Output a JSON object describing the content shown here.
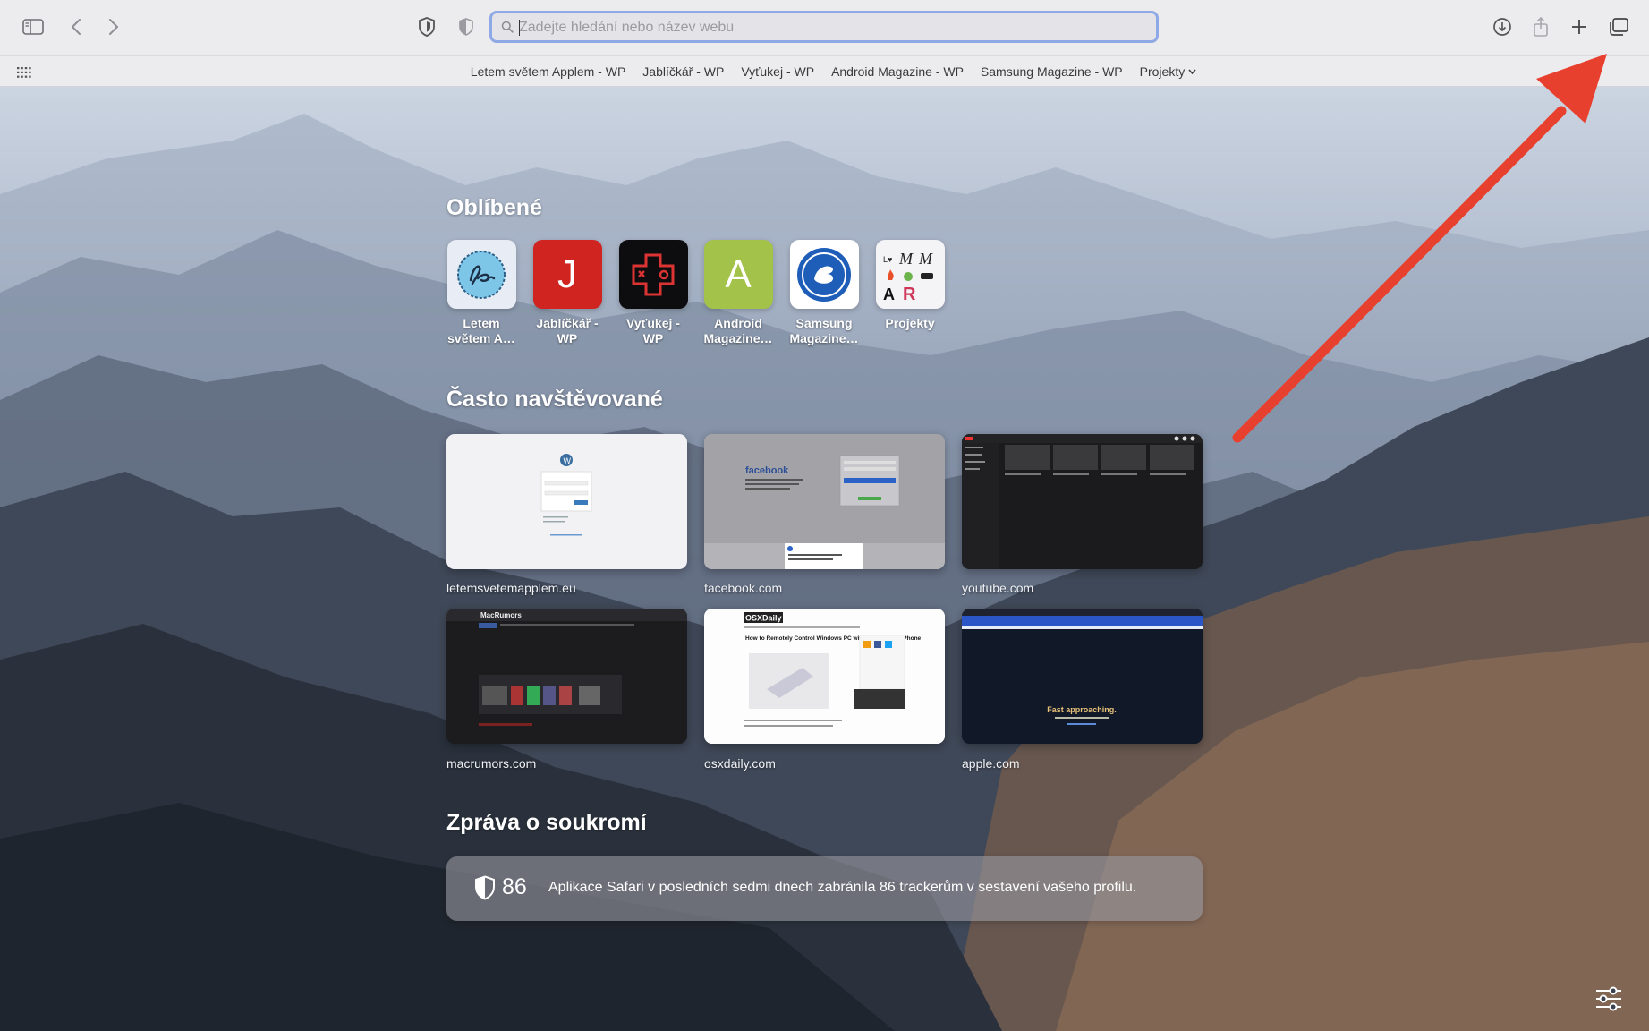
{
  "toolbar": {
    "sidebar_icon": "sidebar-icon",
    "back_icon": "chevron-left-icon",
    "forward_icon": "chevron-right-icon",
    "privacy_icon": "privacy-shield-icon",
    "url_placeholder": "Zadejte hledání nebo název webu",
    "downloads_icon": "download-icon",
    "share_icon": "share-icon",
    "new_tab_icon": "plus-icon",
    "tab_overview_icon": "tab-overview-icon"
  },
  "bookmarks": {
    "items": [
      "Letem světem Applem - WP",
      "Jablíčkář - WP",
      "Vyťukej - WP",
      "Android Magazine - WP",
      "Samsung Magazine - WP"
    ],
    "folder": "Projekty"
  },
  "favorites": {
    "title": "Oblíbené",
    "items": [
      {
        "line1": "Letem",
        "line2": "světem A…"
      },
      {
        "line1": "Jablíčkář -",
        "line2": "WP",
        "letter": "J"
      },
      {
        "line1": "Vyťukej -",
        "line2": "WP"
      },
      {
        "line1": "Android",
        "line2": "Magazine…",
        "letter": "A"
      },
      {
        "line1": "Samsung",
        "line2": "Magazine…"
      },
      {
        "line1": "Projekty",
        "line2": ""
      }
    ]
  },
  "frequent": {
    "title": "Často navštěvované",
    "sites": [
      "letemsvetemapplem.eu",
      "facebook.com",
      "youtube.com",
      "macrumors.com",
      "osxdaily.com",
      "apple.com"
    ],
    "thumb_text": {
      "facebook": "facebook",
      "macrumors": "MacRumors",
      "osxdaily": "OSXDaily",
      "osx_headline": "How to Remotely Control Windows PC with AnyDesk on iPhone",
      "apple_headline": "Fast approaching."
    }
  },
  "privacy": {
    "title": "Zpráva o soukromí",
    "count": "86",
    "text": "Aplikace Safari v posledních sedmi dnech zabránila 86 trackerům v sestavení vašeho profilu."
  },
  "colors": {
    "annotation_arrow": "#e8402e",
    "url_focus_ring": "#8fa9e6"
  }
}
